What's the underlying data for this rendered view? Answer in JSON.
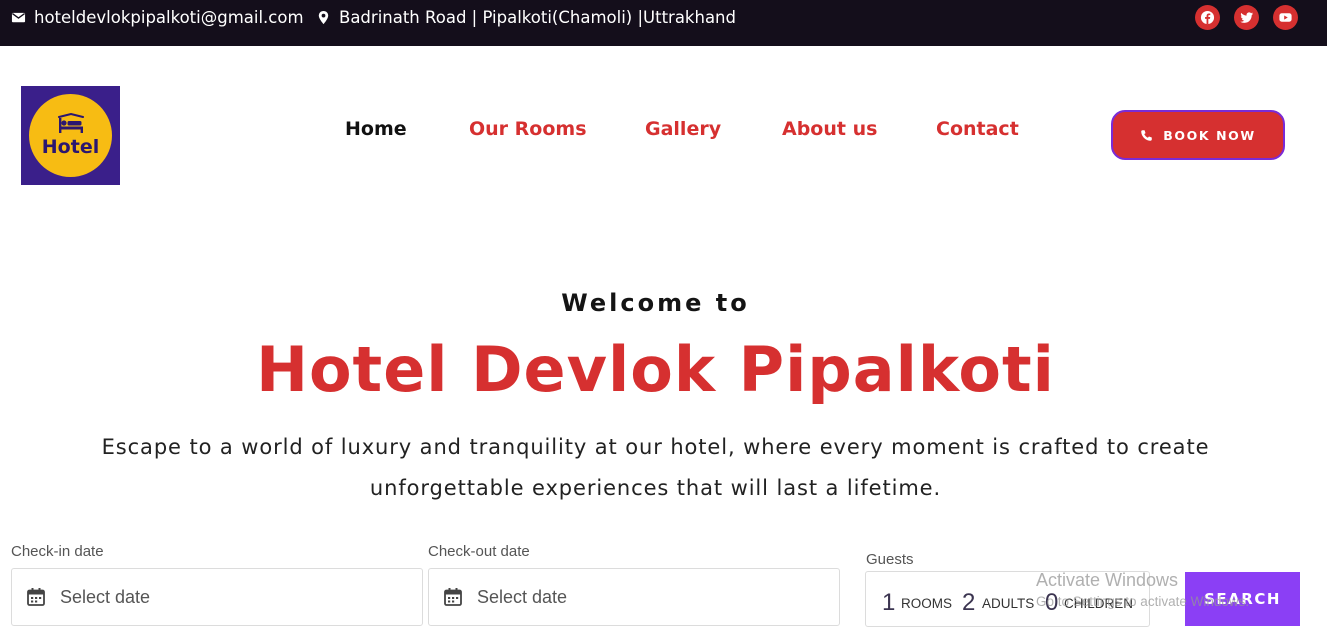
{
  "topbar": {
    "email": "hoteldevlokpipalkoti@gmail.com",
    "address": "Badrinath Road | Pipalkoti(Chamoli) |Uttrakhand",
    "social_icons": [
      "facebook-icon",
      "twitter-icon",
      "youtube-icon"
    ]
  },
  "logo": {
    "text": "Hotel"
  },
  "nav": {
    "items": [
      {
        "label": "Home",
        "active": true
      },
      {
        "label": "Our Rooms"
      },
      {
        "label": "Gallery"
      },
      {
        "label": "About us"
      },
      {
        "label": "Contact"
      }
    ]
  },
  "book_button": {
    "label": "BOOK NOW"
  },
  "hero": {
    "welcome": "Welcome to",
    "title": "Hotel Devlok Pipalkoti",
    "description": "Escape to a world of luxury and tranquility at our hotel, where every moment is crafted to create unforgettable experiences that will last a lifetime."
  },
  "booking": {
    "checkin_label": "Check-in date",
    "checkin_placeholder": "Select date",
    "checkout_label": "Check-out date",
    "checkout_placeholder": "Select date",
    "guests_label": "Guests",
    "rooms_count": "1",
    "rooms_label": "ROOMS",
    "adults_count": "2",
    "adults_label": "ADULTS",
    "children_count": "0",
    "children_label": "CHILDREN",
    "search_label": "SEARCH"
  },
  "watermark": {
    "title": "Activate Windows",
    "subtitle": "Go to Settings to activate Windows."
  },
  "colors": {
    "topbar_bg": "#140e1b",
    "brand_red": "#d63030",
    "search_purple": "#8b3ff5",
    "logo_bg": "#3a1f8a",
    "logo_circle": "#f7bc13"
  }
}
